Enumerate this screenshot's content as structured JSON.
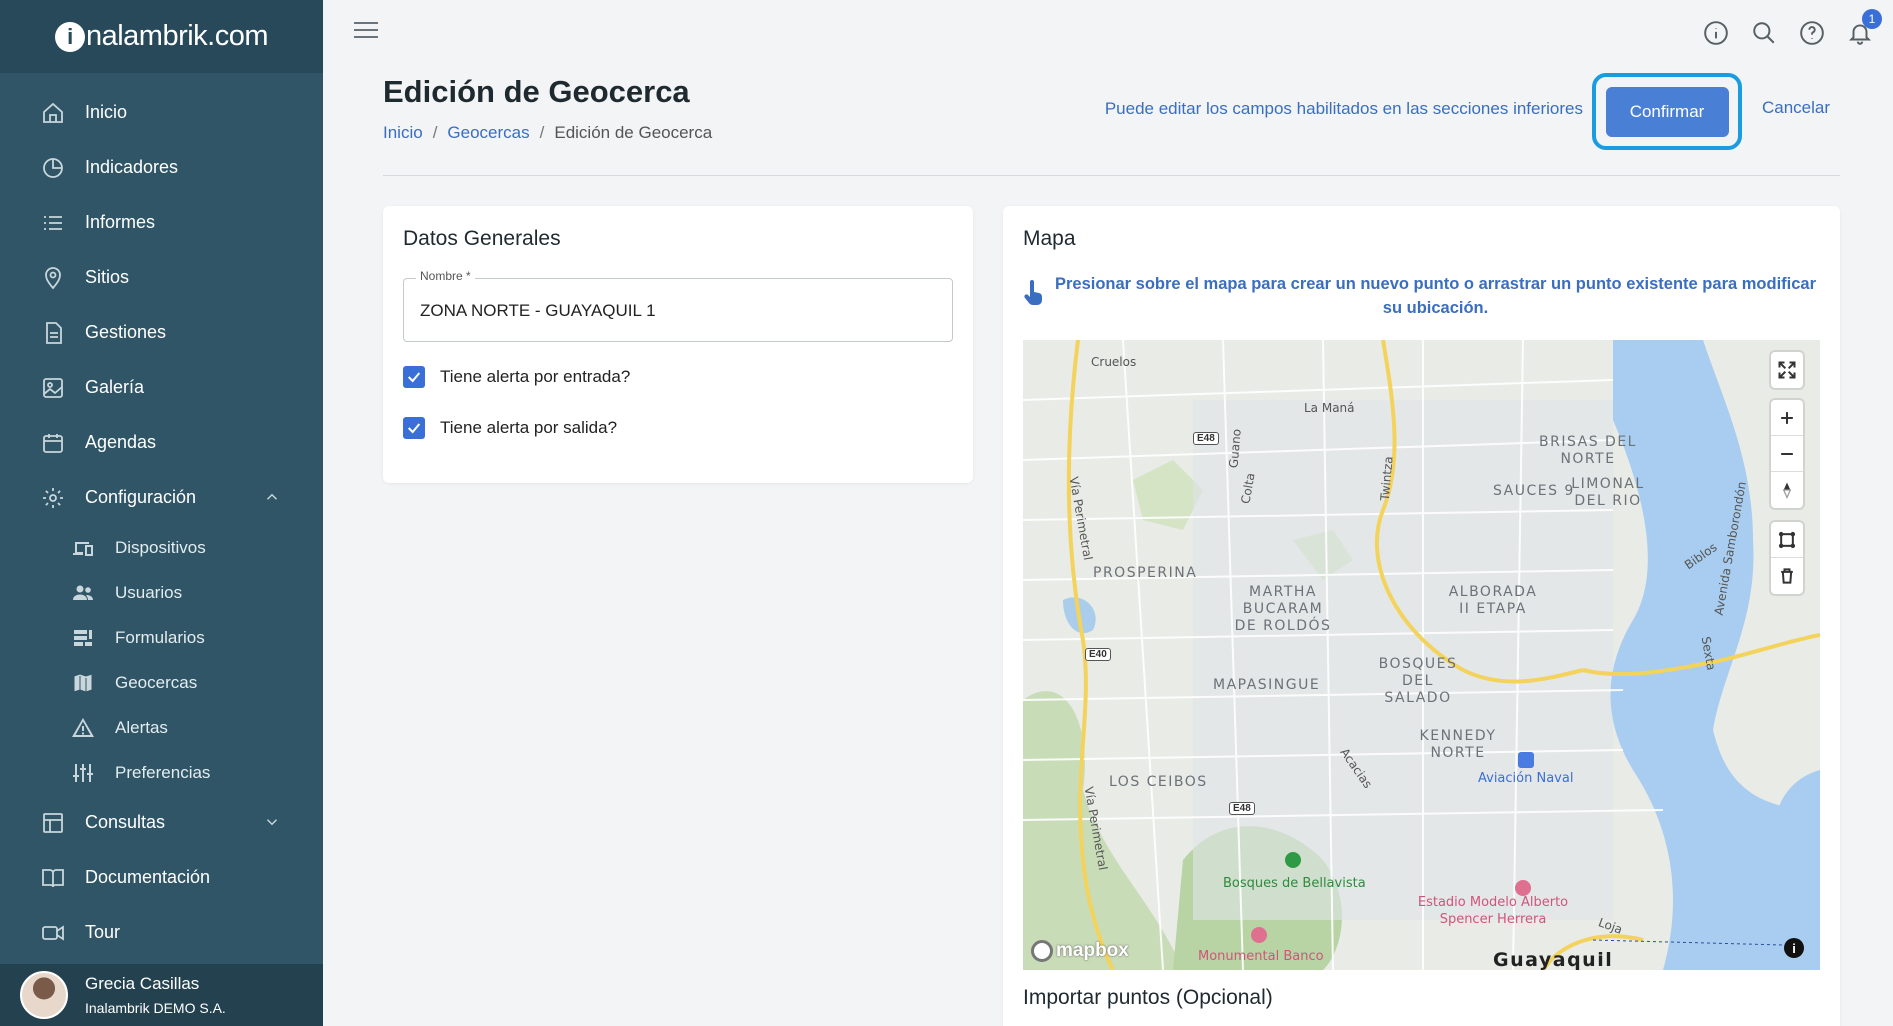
{
  "app": {
    "logo_prefix": "i",
    "logo_rest": "nalambrik.com"
  },
  "sidebar": {
    "items": [
      {
        "label": "Inicio",
        "icon": "home-icon"
      },
      {
        "label": "Indicadores",
        "icon": "pie-chart-icon"
      },
      {
        "label": "Informes",
        "icon": "list-icon"
      },
      {
        "label": "Sitios",
        "icon": "location-pin-icon"
      },
      {
        "label": "Gestiones",
        "icon": "document-icon"
      },
      {
        "label": "Galería",
        "icon": "image-icon"
      },
      {
        "label": "Agendas",
        "icon": "calendar-icon"
      },
      {
        "label": "Configuración",
        "icon": "gear-icon",
        "expanded": true
      }
    ],
    "sub_items": [
      {
        "label": "Dispositivos",
        "icon": "devices-icon"
      },
      {
        "label": "Usuarios",
        "icon": "users-icon"
      },
      {
        "label": "Formularios",
        "icon": "forms-icon"
      },
      {
        "label": "Geocercas",
        "icon": "map-icon"
      },
      {
        "label": "Alertas",
        "icon": "warning-icon"
      },
      {
        "label": "Preferencias",
        "icon": "sliders-icon"
      }
    ],
    "bottom_items": [
      {
        "label": "Consultas",
        "icon": "table-icon",
        "expanded": false
      },
      {
        "label": "Documentación",
        "icon": "book-icon"
      },
      {
        "label": "Tour",
        "icon": "video-icon"
      }
    ],
    "user": {
      "name": "Grecia Casillas",
      "org": "Inalambrik DEMO S.A."
    }
  },
  "topbar": {
    "notification_count": "1"
  },
  "header": {
    "title": "Edición de Geocerca",
    "breadcrumb": [
      "Inicio",
      "Geocercas",
      "Edición de Geocerca"
    ],
    "hint": "Puede editar los campos habilitados en las secciones inferiores",
    "confirm_label": "Confirmar",
    "cancel_label": "Cancelar"
  },
  "general": {
    "title": "Datos Generales",
    "name_label": "Nombre *",
    "name_value": "ZONA NORTE - GUAYAQUIL 1",
    "alert_entry_label": "Tiene alerta por entrada?",
    "alert_entry_checked": true,
    "alert_exit_label": "Tiene alerta por salida?",
    "alert_exit_checked": true
  },
  "map": {
    "title": "Mapa",
    "hint": "Presionar sobre el mapa para crear un nuevo punto o arrastrar un punto existente para modificar su ubicación.",
    "attribution": "mapbox",
    "labels": {
      "cruelos": "Cruelos",
      "la_mana": "La Maná",
      "brisas": "BRISAS DEL NORTE",
      "sauces": "SAUCES 9",
      "limonal": "LIMONAL DEL RIO",
      "prosperina": "PROSPERINA",
      "martha": "MARTHA BUCARAM DE ROLDÓS",
      "alborada": "ALBORADA II ETAPA",
      "bosques_salado": "BOSQUES DEL SALADO",
      "mapasingue": "MAPASINGUE",
      "kennedy": "KENNEDY NORTE",
      "ceibos": "LOS CEIBOS",
      "aviacion": "Aviación Naval",
      "bellavista": "Bosques de Bellavista",
      "estadio": "Estadio Modelo Alberto Spencer Herrera",
      "monumental": "Monumental Banco",
      "via_perimetral": "Vía Perimetral",
      "guano": "Guano",
      "colta": "Colta",
      "twintza": "Twintza",
      "biblos": "Biblos",
      "sexta": "Sexta",
      "samborondon": "Avenida Samborondón",
      "acacias": "Acacias",
      "loja": "Loja",
      "guayaquil": "Guayaquil",
      "e48": "E48",
      "e40": "E40"
    }
  },
  "import": {
    "title": "Importar puntos (Opcional)"
  }
}
